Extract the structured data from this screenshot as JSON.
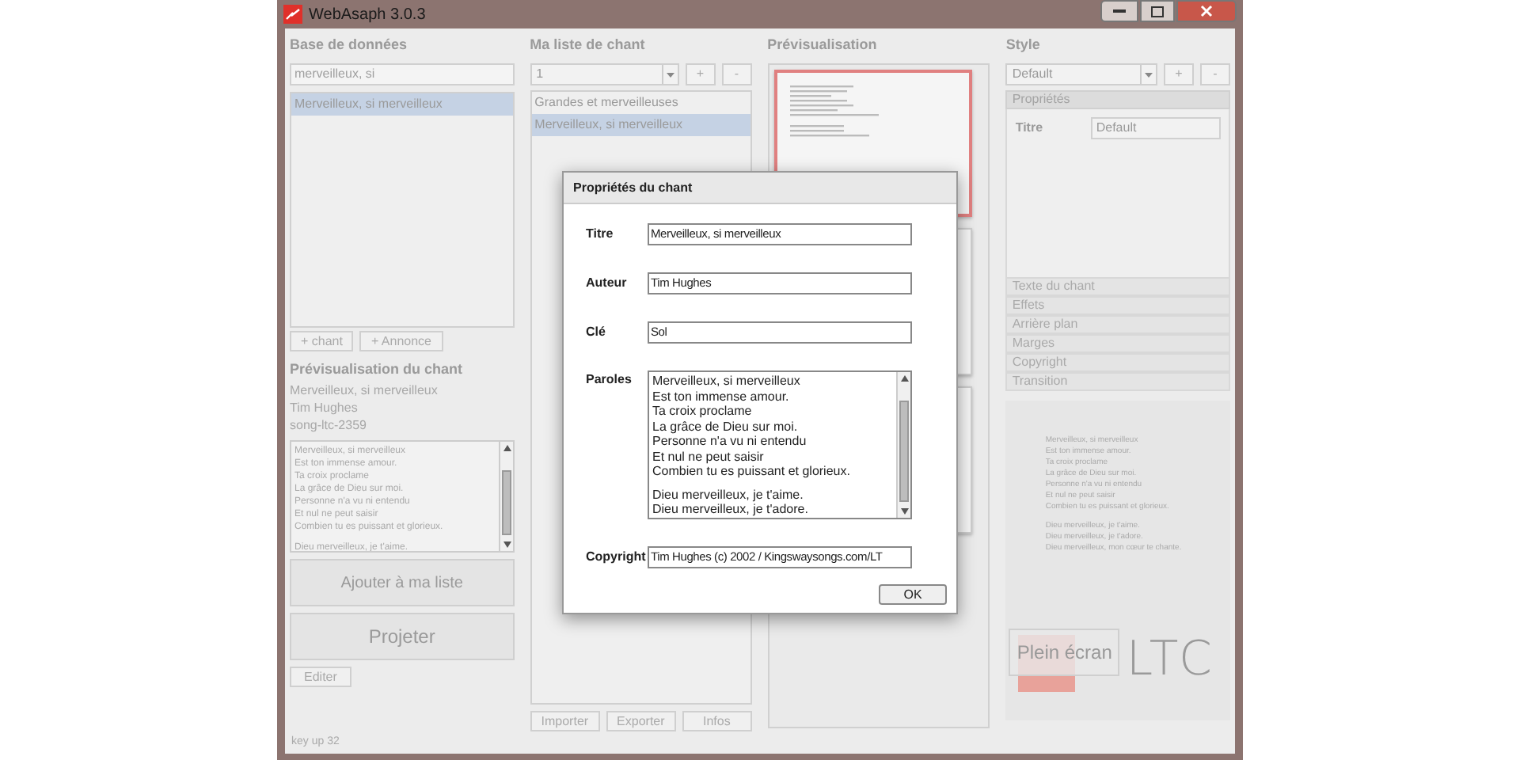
{
  "window": {
    "title": "WebAsaph 3.0.3"
  },
  "database": {
    "heading": "Base de données",
    "search_value": "merveilleux, si",
    "results": [
      {
        "label": "Merveilleux, si merveilleux",
        "selected": true
      }
    ],
    "buttons": [
      "+ chant",
      "+ Annonce"
    ]
  },
  "song_preview": {
    "heading": "Prévisualisation du chant",
    "meta": [
      "Merveilleux, si merveilleux",
      "Tim Hughes",
      "song-ltc-2359"
    ],
    "lyrics": [
      [
        "Merveilleux, si merveilleux",
        "Est ton immense amour.",
        "Ta croix proclame",
        "La grâce de Dieu sur moi.",
        "Personne n'a vu ni entendu",
        "Et nul ne peut saisir",
        "Combien tu es puissant et glorieux."
      ],
      [
        "Dieu merveilleux, je t'aime."
      ]
    ],
    "big_buttons": [
      "Ajouter à ma liste",
      "Projeter"
    ],
    "edit_button": "Editer"
  },
  "my_list": {
    "heading": "Ma liste de chant",
    "selector": "1",
    "selector_buttons": [
      "+",
      "-"
    ],
    "items": [
      {
        "label": "Grandes et merveilleuses",
        "selected": false
      },
      {
        "label": "Merveilleux, si merveilleux",
        "selected": true
      }
    ],
    "buttons": [
      "Importer",
      "Exporter",
      "Infos"
    ]
  },
  "preview": {
    "heading": "Prévisualisation",
    "slides": [
      {
        "selected": true
      },
      {
        "selected": false
      },
      {
        "selected": false
      }
    ]
  },
  "style": {
    "heading": "Style",
    "selector": "Default",
    "selector_buttons": [
      "+",
      "-"
    ],
    "open_section": {
      "label": "Propriétés",
      "properties": [
        {
          "label": "Titre",
          "value": "Default"
        }
      ]
    },
    "sections": [
      "Texte du chant",
      "Effets",
      "Arrière plan",
      "Marges",
      "Copyright",
      "Transition"
    ],
    "lyrics": [
      [
        "Merveilleux, si merveilleux",
        "Est ton immense amour.",
        "Ta croix proclame",
        "La grâce de Dieu sur moi.",
        "Personne n'a vu ni entendu",
        "Et nul ne peut saisir",
        "Combien tu es puissant et glorieux."
      ],
      [
        "Dieu merveilleux, je t'aime.",
        "Dieu merveilleux, je t'adore.",
        "Dieu merveilleux, mon cœur te chante."
      ]
    ],
    "fullscreen_button": "Plein écran",
    "logo_text": "LTC"
  },
  "status_bar": {
    "text": "key up 32"
  },
  "dialog": {
    "title": "Propriétés du chant",
    "fields": [
      {
        "kind": "line",
        "label": "Titre",
        "value": "Merveilleux, si merveilleux"
      },
      {
        "kind": "line",
        "label": "Auteur",
        "value": "Tim Hughes"
      },
      {
        "kind": "line",
        "label": "Clé",
        "value": "Sol"
      },
      {
        "kind": "multiline",
        "label": "Paroles",
        "lines": [
          [
            "Merveilleux, si merveilleux",
            "Est ton immense amour.",
            "Ta croix proclame",
            "La grâce de Dieu sur moi.",
            "Personne n'a vu ni entendu",
            "Et nul ne peut saisir",
            "Combien tu es puissant et glorieux."
          ],
          [
            "Dieu merveilleux, je t'aime.",
            "Dieu merveilleux, je t'adore."
          ]
        ]
      },
      {
        "kind": "line",
        "label": "Copyright",
        "value": "Tim Hughes (c) 2002  / Kingswaysongs.com/LT"
      }
    ],
    "button": "OK"
  }
}
